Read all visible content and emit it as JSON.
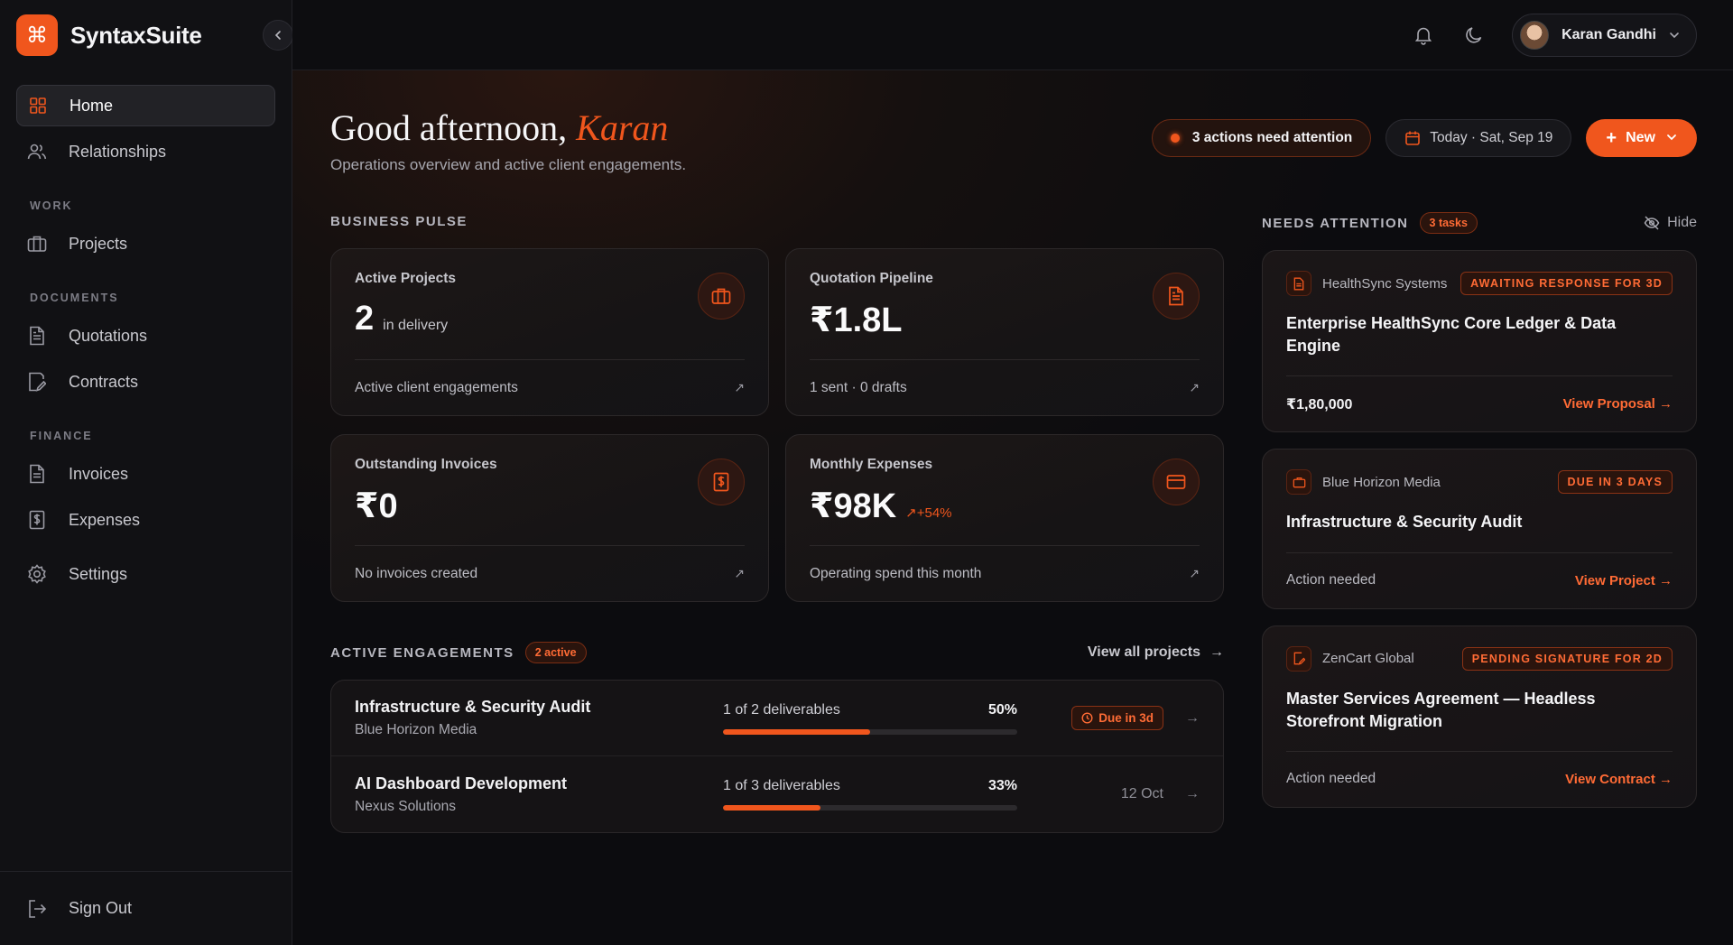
{
  "brand": {
    "name": "SyntaxSuite",
    "logo_icon": "command-icon",
    "collapse_icon": "chevron-left-icon"
  },
  "sidebar": {
    "items": [
      {
        "label": "Home",
        "icon": "grid-icon",
        "active": true
      },
      {
        "label": "Relationships",
        "icon": "users-icon"
      }
    ],
    "sections": [
      {
        "title": "WORK",
        "items": [
          {
            "label": "Projects",
            "icon": "briefcase-icon"
          }
        ]
      },
      {
        "title": "DOCUMENTS",
        "items": [
          {
            "label": "Quotations",
            "icon": "file-text-icon"
          },
          {
            "label": "Contracts",
            "icon": "file-edit-icon"
          }
        ]
      },
      {
        "title": "FINANCE",
        "items": [
          {
            "label": "Invoices",
            "icon": "file-invoice-icon"
          },
          {
            "label": "Expenses",
            "icon": "receipt-dollar-icon"
          }
        ]
      }
    ],
    "settings": {
      "label": "Settings",
      "icon": "gear-icon"
    },
    "sign_out": {
      "label": "Sign Out",
      "icon": "logout-icon"
    }
  },
  "topbar": {
    "notification_icon": "bell-icon",
    "theme_icon": "moon-icon",
    "user": {
      "name": "Karan Gandhi"
    }
  },
  "header": {
    "greeting_prefix": "Good afternoon,",
    "greeting_name": "Karan",
    "subtitle": "Operations overview and active client engagements.",
    "attention": "3 actions need attention",
    "date": "Today · Sat, Sep 19",
    "new_button": "New"
  },
  "pulse": {
    "title": "BUSINESS PULSE",
    "cards": [
      {
        "label": "Active Projects",
        "value": "2",
        "unit": "in delivery",
        "delta": "",
        "footer": "Active client engagements",
        "icon": "briefcase-icon"
      },
      {
        "label": "Quotation Pipeline",
        "value": "₹1.8L",
        "unit": "",
        "delta": "",
        "footer": "1 sent · 0 drafts",
        "icon": "file-text-icon"
      },
      {
        "label": "Outstanding Invoices",
        "value": "₹0",
        "unit": "",
        "delta": "",
        "footer": "No invoices created",
        "icon": "receipt-dollar-icon"
      },
      {
        "label": "Monthly Expenses",
        "value": "₹98K",
        "unit": "",
        "delta": "+54%",
        "footer": "Operating spend this month",
        "icon": "credit-card-icon"
      }
    ]
  },
  "engagements": {
    "title": "ACTIVE ENGAGEMENTS",
    "badge": "2 active",
    "view_all": "View all projects",
    "rows": [
      {
        "title": "Infrastructure & Security Audit",
        "client": "Blue Horizon Media",
        "progress_text": "1 of 2 deliverables",
        "percent": "50%",
        "progress": 0.5,
        "due": "Due in 3d",
        "due_style": "badge"
      },
      {
        "title": "AI Dashboard Development",
        "client": "Nexus Solutions",
        "progress_text": "1 of 3 deliverables",
        "percent": "33%",
        "progress": 0.33,
        "due": "12 Oct",
        "due_style": "plain"
      }
    ]
  },
  "attention": {
    "title": "NEEDS ATTENTION",
    "badge": "3 tasks",
    "hide": "Hide",
    "items": [
      {
        "client": "HealthSync Systems",
        "status": "AWAITING RESPONSE FOR 3D",
        "title": "Enterprise HealthSync Core Ledger & Data Engine",
        "amount": "₹1,80,000",
        "note": "",
        "link": "View Proposal →",
        "icon": "file-text-icon"
      },
      {
        "client": "Blue Horizon Media",
        "status": "DUE IN 3 DAYS",
        "title": "Infrastructure & Security Audit",
        "amount": "",
        "note": "Action needed",
        "link": "View Project →",
        "icon": "briefcase-icon"
      },
      {
        "client": "ZenCart Global",
        "status": "PENDING SIGNATURE FOR 2D",
        "title": "Master Services Agreement — Headless Storefront Migration",
        "amount": "",
        "note": "Action needed",
        "link": "View Contract →",
        "icon": "file-edit-icon"
      }
    ]
  },
  "colors": {
    "accent": "#f0561d",
    "background": "#0b0b0d",
    "sidebar": "#111114"
  }
}
